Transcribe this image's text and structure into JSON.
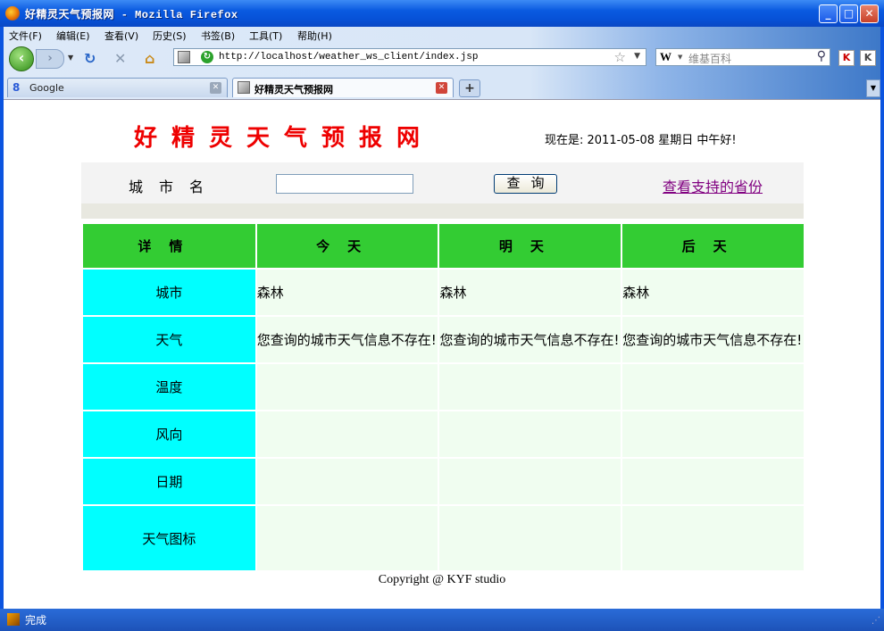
{
  "window": {
    "title": "好精灵天气预报网 - Mozilla Firefox",
    "controls": {
      "minimize": "_",
      "maximize": "□",
      "close": "✕"
    }
  },
  "menu": {
    "items": [
      "文件(F)",
      "编辑(E)",
      "查看(V)",
      "历史(S)",
      "书签(B)",
      "工具(T)",
      "帮助(H)"
    ]
  },
  "nav": {
    "back_glyph": "‹",
    "forward_glyph": "›",
    "reload_glyph": "↻",
    "stop_glyph": "✕",
    "home_glyph": "⌂",
    "url": "http://localhost/weather_ws_client/index.jsp",
    "search_engine": "W",
    "search_placeholder": "维基百科"
  },
  "tabs": [
    {
      "label": "Google",
      "active": false
    },
    {
      "label": "好精灵天气预报网",
      "active": true
    }
  ],
  "page": {
    "site_title": "好精灵天气预报网",
    "now_text": "现在是: 2011-05-08 星期日  中午好!",
    "city_label": "城市名",
    "query_button": "查询",
    "provinces_link": "查看支持的省份",
    "table": {
      "headers": [
        "详情",
        "今天",
        "明天",
        "后天"
      ],
      "rows": [
        {
          "label": "城市",
          "values": [
            "森林",
            "森林",
            "森林"
          ]
        },
        {
          "label": "天气",
          "values": [
            "您查询的城市天气信息不存在!",
            "您查询的城市天气信息不存在!",
            "您查询的城市天气信息不存在!"
          ]
        },
        {
          "label": "温度",
          "values": [
            "",
            "",
            ""
          ]
        },
        {
          "label": "风向",
          "values": [
            "",
            "",
            ""
          ]
        },
        {
          "label": "日期",
          "values": [
            "",
            "",
            ""
          ]
        },
        {
          "label": "天气图标",
          "values": [
            "",
            "",
            ""
          ]
        }
      ]
    },
    "copyright": "Copyright @ KYF studio"
  },
  "status": {
    "text": "完成"
  },
  "colors": {
    "title_red": "#ee0000",
    "header_green": "#33cc33",
    "label_cyan": "#00ffff",
    "cell_bg": "#f0fdf0",
    "link_purple": "#800080"
  }
}
